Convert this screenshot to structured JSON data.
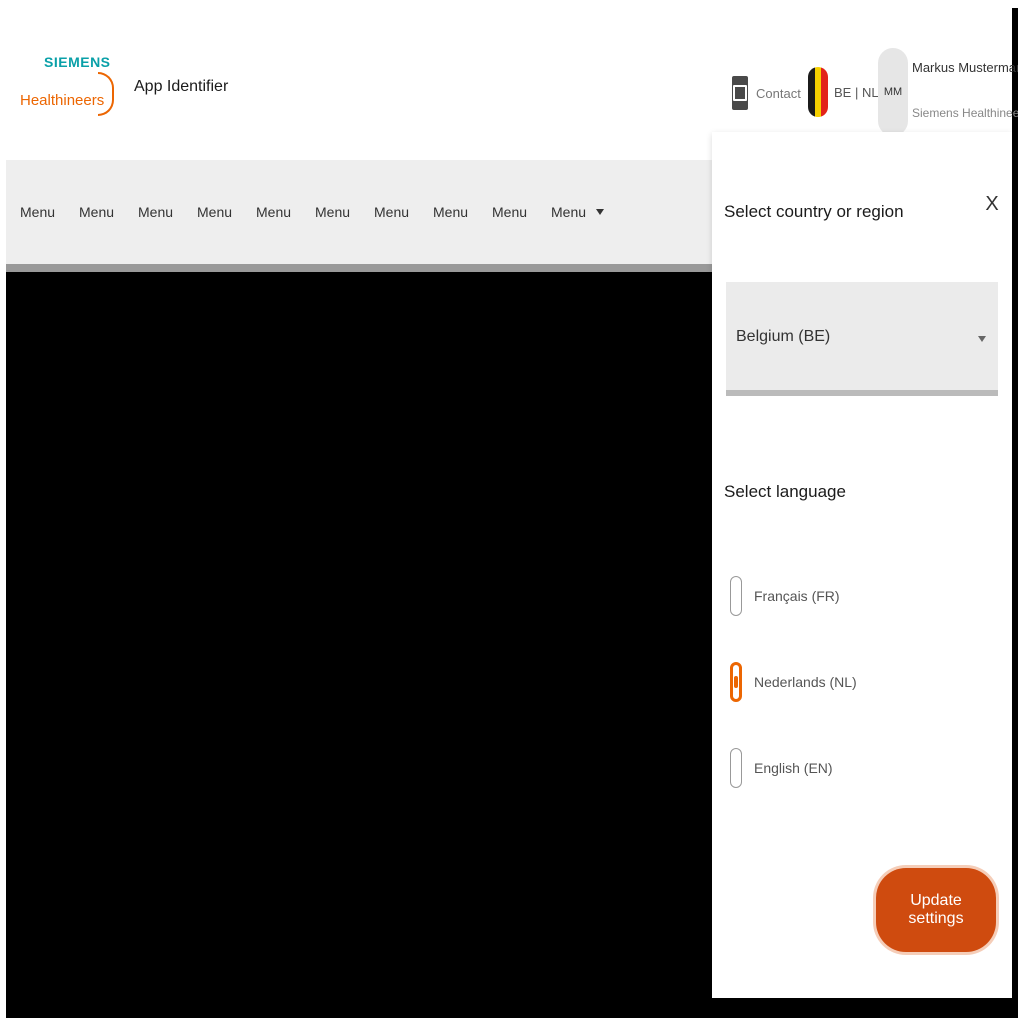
{
  "header": {
    "logo": {
      "brand": "SIEMENS",
      "product": "Healthineers"
    },
    "app_identifier": "App Identifier",
    "contact_label": "Contact",
    "locale_label": "BE | NL",
    "user": {
      "initials": "MM",
      "name": "Markus Mustermann",
      "organization": "Siemens Healthineers"
    }
  },
  "menu": {
    "items": [
      {
        "label": "Menu"
      },
      {
        "label": "Menu"
      },
      {
        "label": "Menu"
      },
      {
        "label": "Menu"
      },
      {
        "label": "Menu"
      },
      {
        "label": "Menu"
      },
      {
        "label": "Menu"
      },
      {
        "label": "Menu"
      },
      {
        "label": "Menu"
      },
      {
        "label": "Menu",
        "has_dropdown": true
      }
    ]
  },
  "panel": {
    "title": "Select country or region",
    "close_label": "X",
    "country_select": {
      "value": "Belgium (BE)"
    },
    "language_title": "Select language",
    "languages": [
      {
        "label": "Français (FR)",
        "checked": false
      },
      {
        "label": "Nederlands (NL)",
        "checked": true
      },
      {
        "label": "English (EN)",
        "checked": false
      }
    ],
    "update_button": "Update settings"
  },
  "colors": {
    "accent": "#ec6602",
    "button": "#cf4b0f",
    "brand_teal": "#0aa0a8",
    "flag": [
      "#1b1b1b",
      "#f5d000",
      "#e2231a"
    ]
  },
  "icons": {
    "contact": "contact-icon",
    "flag": "belgium-flag-icon",
    "dropdown": "chevron-down-icon",
    "close": "close-icon"
  }
}
